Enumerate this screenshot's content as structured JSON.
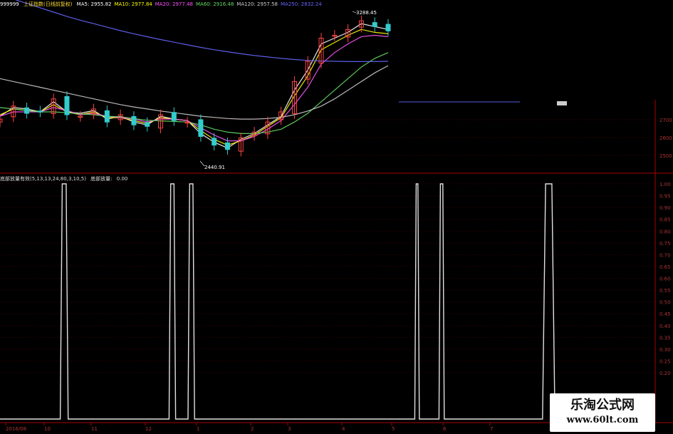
{
  "top_header": {
    "code": "999999",
    "name": "上证指数(日线前复权)",
    "ma_items": [
      {
        "label": "MA5:",
        "value": "2955.82",
        "color": "#ffffff"
      },
      {
        "label": "MA10:",
        "value": "2977.84",
        "color": "#ffff00"
      },
      {
        "label": "MA20:",
        "value": "2977.48",
        "color": "#ff55ff"
      },
      {
        "label": "MA60:",
        "value": "2916.48",
        "color": "#66dd66"
      },
      {
        "label": "MA120:",
        "value": "2957.58",
        "color": "#cccccc"
      },
      {
        "label": "MA250:",
        "value": "2832.24",
        "color": "#6666ff"
      }
    ]
  },
  "indicator_header": {
    "title": "底部放量有效(5,13,13,24,80,3,10,5)",
    "label": "底部放量:",
    "value": "0.00"
  },
  "watermark": {
    "line1": "乐淘公式网",
    "line2": "www.60lt.com"
  },
  "colors": {
    "background": "#000000",
    "separator": "#aa0000",
    "up_candle": "#ff4444",
    "down_candle": "#33cccc",
    "indicator_line": "#e0e0e0"
  },
  "chart_data": [
    {
      "type": "line",
      "title": "",
      "note": "price panel: candlestick with moving averages",
      "annotations": [
        {
          "text": "3288.45",
          "kind": "high"
        },
        {
          "text": "2440.91",
          "kind": "low"
        }
      ],
      "y_ticks": [
        "2700",
        "2600",
        "2500"
      ],
      "x_ticks": [
        "2016/08",
        "10",
        "11",
        "12",
        "1",
        "2",
        "3",
        "4",
        "5",
        "6",
        "7"
      ],
      "series": [
        {
          "name": "MA5",
          "values": [
            2960,
            2990,
            2985,
            2975,
            3010,
            2975,
            2970,
            2980,
            2950,
            2960,
            2940,
            2930,
            2960,
            2950,
            2945,
            2900,
            2870,
            2850,
            2880,
            2900,
            2930,
            2960,
            3050,
            3120,
            3210,
            3230,
            3250,
            3280,
            3270,
            3260
          ]
        },
        {
          "name": "MA10",
          "values": [
            2965,
            2985,
            2980,
            2975,
            3000,
            2975,
            2965,
            2975,
            2955,
            2955,
            2945,
            2935,
            2955,
            2950,
            2945,
            2910,
            2880,
            2860,
            2875,
            2895,
            2925,
            2955,
            3030,
            3100,
            3190,
            3215,
            3240,
            3260,
            3250,
            3245
          ]
        },
        {
          "name": "MA20",
          "values": [
            2960,
            2975,
            2975,
            2975,
            2990,
            2980,
            2965,
            2970,
            2960,
            2955,
            2950,
            2940,
            2950,
            2950,
            2945,
            2920,
            2895,
            2875,
            2875,
            2890,
            2915,
            2945,
            3000,
            3060,
            3140,
            3180,
            3210,
            3235,
            3240,
            3235
          ]
        },
        {
          "name": "MA60",
          "values": [
            2990,
            2985,
            2980,
            2975,
            2975,
            2972,
            2968,
            2965,
            2960,
            2958,
            2952,
            2946,
            2944,
            2942,
            2940,
            2930,
            2915,
            2905,
            2900,
            2900,
            2905,
            2915,
            2940,
            2970,
            3010,
            3050,
            3090,
            3130,
            3160,
            3180
          ]
        },
        {
          "name": "MA120",
          "values": [
            3090,
            3080,
            3070,
            3060,
            3050,
            3040,
            3030,
            3020,
            3010,
            3000,
            2992,
            2985,
            2978,
            2972,
            2966,
            2960,
            2956,
            2952,
            2950,
            2950,
            2952,
            2956,
            2965,
            2978,
            2995,
            3020,
            3050,
            3080,
            3110,
            3135
          ]
        },
        {
          "name": "MA250",
          "values": [
            3380,
            3365,
            3350,
            3335,
            3320,
            3305,
            3292,
            3280,
            3268,
            3256,
            3245,
            3235,
            3225,
            3216,
            3207,
            3198,
            3190,
            3183,
            3176,
            3170,
            3165,
            3160,
            3156,
            3153,
            3151,
            3150,
            3149,
            3149,
            3149,
            3150
          ]
        }
      ],
      "candles_close": [
        2950,
        2995,
        2970,
        2975,
        3020,
        2965,
        2960,
        2985,
        2940,
        2965,
        2930,
        2925,
        2965,
        2945,
        2940,
        2890,
        2860,
        2845,
        2885,
        2905,
        2940,
        2975,
        3080,
        3150,
        3230,
        3240,
        3260,
        3290,
        3270,
        3255
      ]
    },
    {
      "type": "line",
      "title": "",
      "note": "indicator panel: 底部放量 signal (0 or 1)",
      "y_ticks": [
        "1.00",
        "0.95",
        "0.90",
        "0.85",
        "0.80",
        "0.75",
        "0.70",
        "0.65",
        "0.60",
        "0.55",
        "0.50",
        "0.45",
        "0.40",
        "0.35",
        "0.30",
        "0.25",
        "0.20"
      ],
      "ylim": [
        0,
        1
      ],
      "signals": [
        {
          "start": 0.092,
          "end": 0.104
        },
        {
          "start": 0.258,
          "end": 0.268
        },
        {
          "start": 0.287,
          "end": 0.297
        },
        {
          "start": 0.633,
          "end": 0.64
        },
        {
          "start": 0.67,
          "end": 0.678
        },
        {
          "start": 0.828,
          "end": 0.847
        }
      ]
    }
  ]
}
